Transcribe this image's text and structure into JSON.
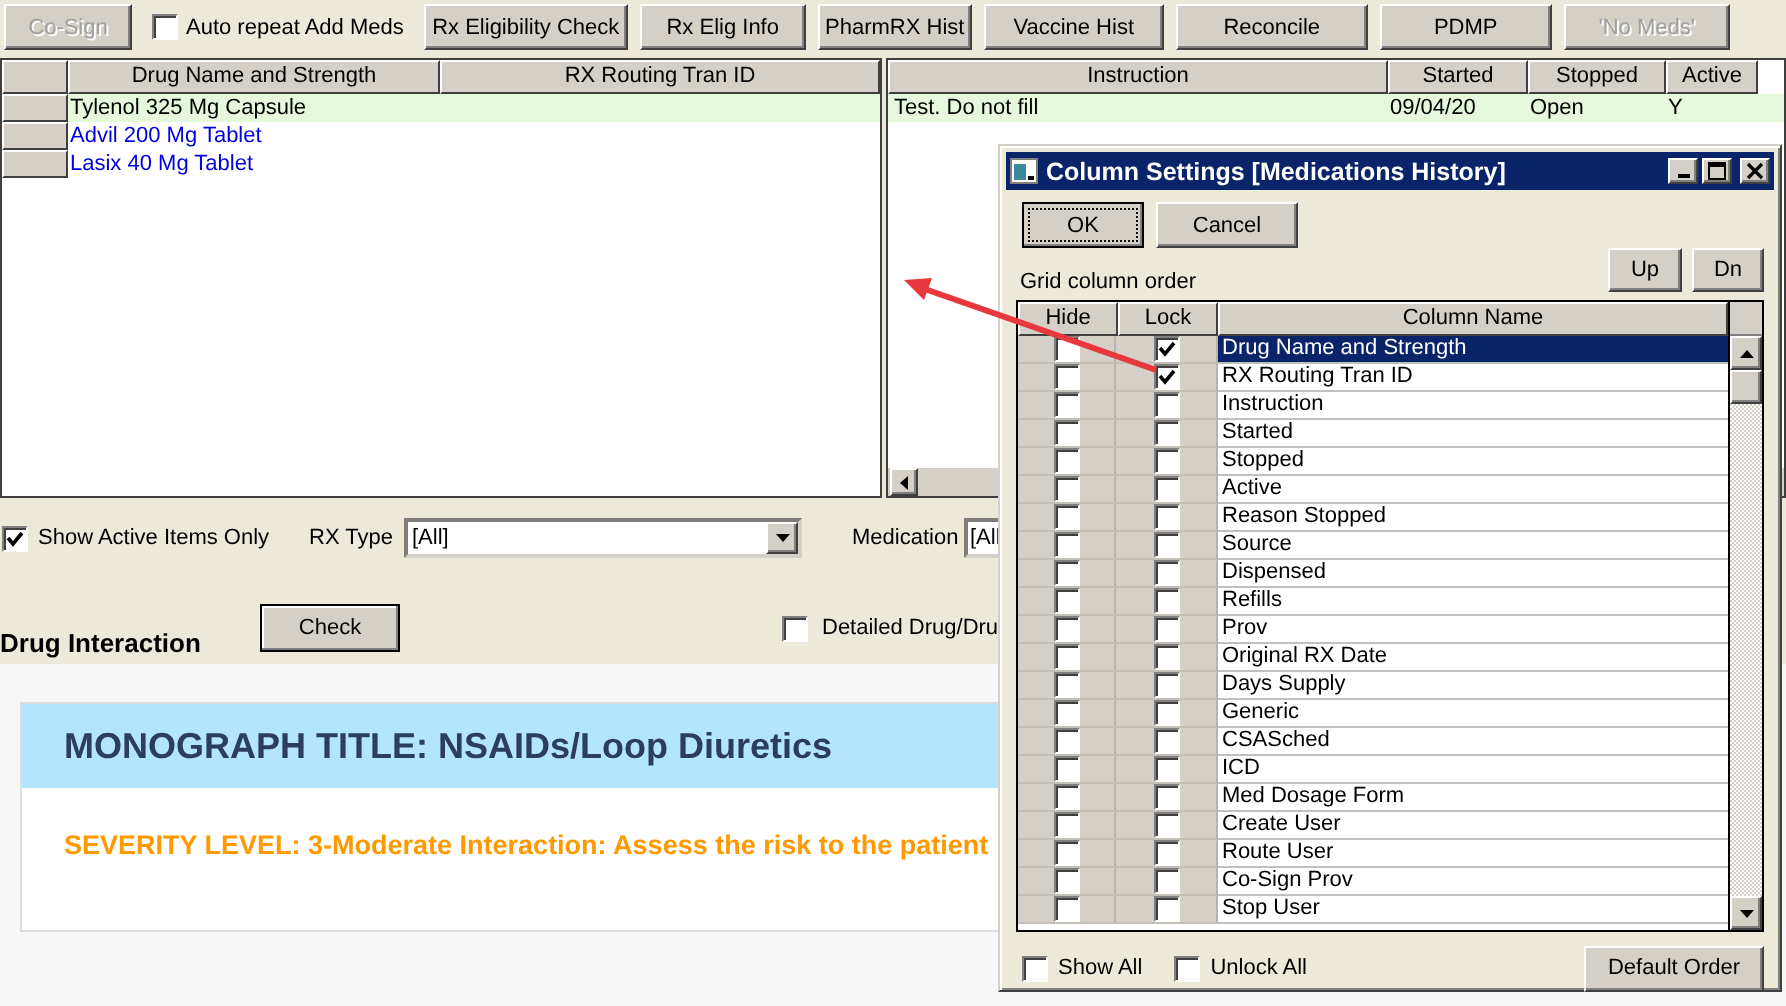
{
  "toolbar": [
    {
      "kind": "button",
      "label": "Co-Sign",
      "disabled": true
    },
    {
      "kind": "checkbox",
      "label": "Auto repeat Add Meds",
      "checked": false
    },
    {
      "kind": "button",
      "label": "Rx Eligibility Check",
      "disabled": false
    },
    {
      "kind": "button",
      "label": "Rx Elig Info",
      "disabled": false
    },
    {
      "kind": "button",
      "label": "PharmRX Hist",
      "disabled": false
    },
    {
      "kind": "button",
      "label": "Vaccine Hist",
      "disabled": false
    },
    {
      "kind": "button",
      "label": "Reconcile",
      "disabled": false
    },
    {
      "kind": "button",
      "label": "PDMP",
      "disabled": false
    },
    {
      "kind": "button",
      "label": "'No Meds'",
      "disabled": true
    }
  ],
  "medications": {
    "left_columns": [
      "Drug Name and Strength",
      "RX Routing Tran ID"
    ],
    "right_columns": [
      "Instruction",
      "Started",
      "Stopped",
      "Active"
    ],
    "rows": [
      {
        "selected": true,
        "drug": "Tylenol 325 Mg Capsule",
        "instruction": "Test. Do not fill",
        "started": "09/04/20",
        "stopped": "Open",
        "active": "Y"
      },
      {
        "selected": false,
        "drug": "Advil 200 Mg Tablet"
      },
      {
        "selected": false,
        "drug": "Lasix 40 Mg Tablet"
      }
    ]
  },
  "filters": {
    "show_active": {
      "label": "Show Active Items Only",
      "checked": true
    },
    "rx_type": {
      "label": "RX Type",
      "value": "[All]"
    },
    "medication": {
      "label": "Medication",
      "value": "[All"
    }
  },
  "drug_interaction": {
    "title": "Drug Interaction",
    "button": "Check",
    "detailed": {
      "label": "Detailed Drug/Dru",
      "checked": false
    }
  },
  "monograph": {
    "title": "MONOGRAPH TITLE: NSAIDs/Loop Diuretics",
    "severity": "SEVERITY LEVEL: 3-Moderate Interaction: Assess the risk to the patient"
  },
  "dialog": {
    "title": "Column Settings [Medications History]",
    "ok": "OK",
    "cancel": "Cancel",
    "up": "Up",
    "down": "Dn",
    "grid_label": "Grid column order",
    "columns": [
      "Hide",
      "Lock",
      "Column Name"
    ],
    "rows": [
      {
        "name": "Drug Name and Strength",
        "hide": false,
        "lock": true,
        "selected": true
      },
      {
        "name": "RX Routing Tran ID",
        "hide": false,
        "lock": true,
        "selected": false
      },
      {
        "name": "Instruction",
        "hide": false,
        "lock": false,
        "selected": false
      },
      {
        "name": "Started",
        "hide": false,
        "lock": false,
        "selected": false
      },
      {
        "name": "Stopped",
        "hide": false,
        "lock": false,
        "selected": false
      },
      {
        "name": "Active",
        "hide": false,
        "lock": false,
        "selected": false
      },
      {
        "name": "Reason Stopped",
        "hide": false,
        "lock": false,
        "selected": false
      },
      {
        "name": "Source",
        "hide": false,
        "lock": false,
        "selected": false
      },
      {
        "name": "Dispensed",
        "hide": false,
        "lock": false,
        "selected": false
      },
      {
        "name": "Refills",
        "hide": false,
        "lock": false,
        "selected": false
      },
      {
        "name": "Prov",
        "hide": false,
        "lock": false,
        "selected": false
      },
      {
        "name": "Original RX Date",
        "hide": false,
        "lock": false,
        "selected": false
      },
      {
        "name": "Days Supply",
        "hide": false,
        "lock": false,
        "selected": false
      },
      {
        "name": "Generic",
        "hide": false,
        "lock": false,
        "selected": false
      },
      {
        "name": "CSASched",
        "hide": false,
        "lock": false,
        "selected": false
      },
      {
        "name": "ICD",
        "hide": false,
        "lock": false,
        "selected": false
      },
      {
        "name": "Med Dosage Form",
        "hide": false,
        "lock": false,
        "selected": false
      },
      {
        "name": "Create User",
        "hide": false,
        "lock": false,
        "selected": false
      },
      {
        "name": "Route User",
        "hide": false,
        "lock": false,
        "selected": false
      },
      {
        "name": "Co-Sign Prov",
        "hide": false,
        "lock": false,
        "selected": false
      },
      {
        "name": "Stop User",
        "hide": false,
        "lock": false,
        "selected": false
      }
    ],
    "show_all": {
      "label": "Show All",
      "checked": false
    },
    "unlock_all": {
      "label": "Unlock All",
      "checked": false
    },
    "default_order": "Default Order"
  }
}
